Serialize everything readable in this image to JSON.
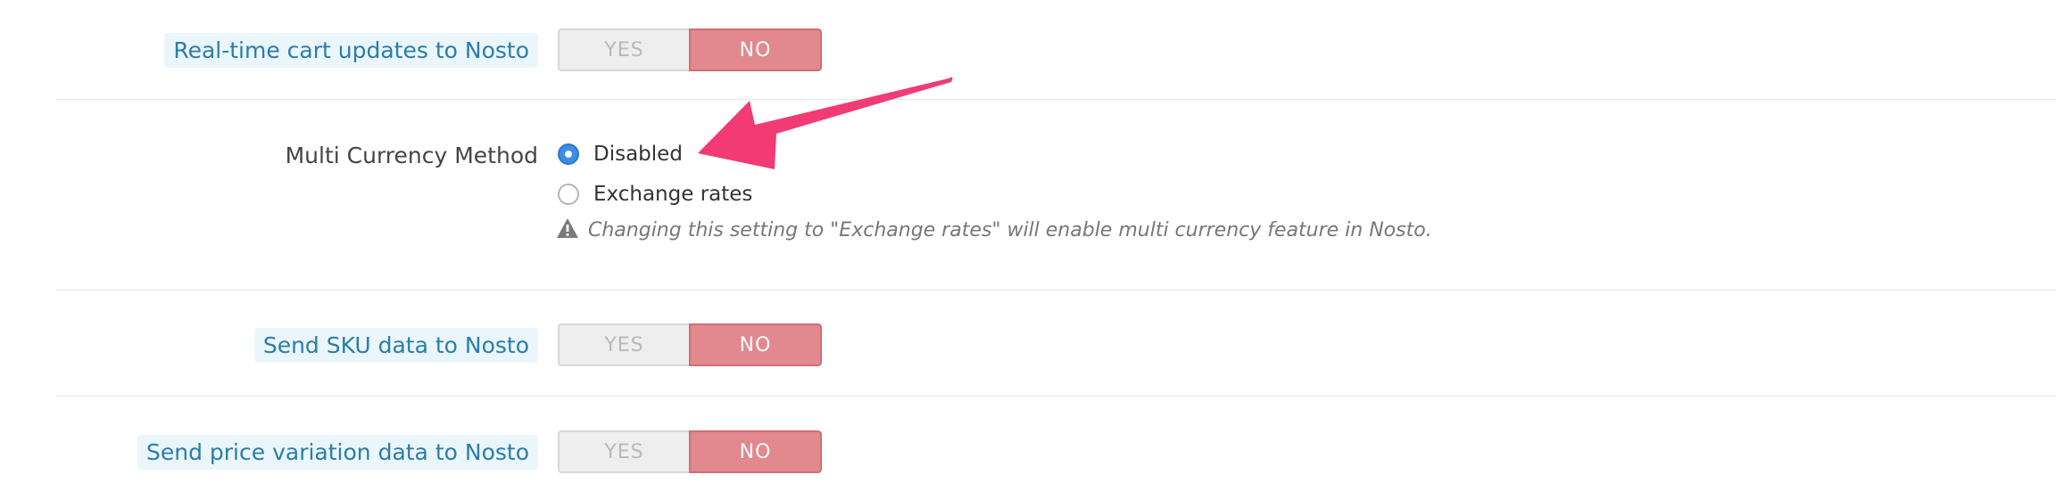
{
  "settings": {
    "realtime_cart": {
      "label": "Real-time cart updates to Nosto",
      "yes": "YES",
      "no": "NO",
      "selected": "NO"
    },
    "multi_currency": {
      "label": "Multi Currency Method",
      "options": [
        {
          "label": "Disabled",
          "checked": true
        },
        {
          "label": "Exchange rates",
          "checked": false
        }
      ],
      "help": "Changing this setting to \"Exchange rates\" will enable multi currency feature in Nosto."
    },
    "send_sku": {
      "label": "Send SKU data to Nosto",
      "yes": "YES",
      "no": "NO",
      "selected": "NO"
    },
    "send_price_variation": {
      "label": "Send price variation data to Nosto",
      "yes": "YES",
      "no": "NO",
      "selected": "NO"
    }
  },
  "colors": {
    "label_text": "#2a7da8",
    "label_bg": "#eaf6fb",
    "no_active": "#e2888f",
    "radio_checked": "#3b8de6",
    "annotation_arrow": "#f23a74"
  },
  "icons": {
    "warning": "warning-triangle-icon",
    "annotation": "pointer-arrow-icon"
  }
}
